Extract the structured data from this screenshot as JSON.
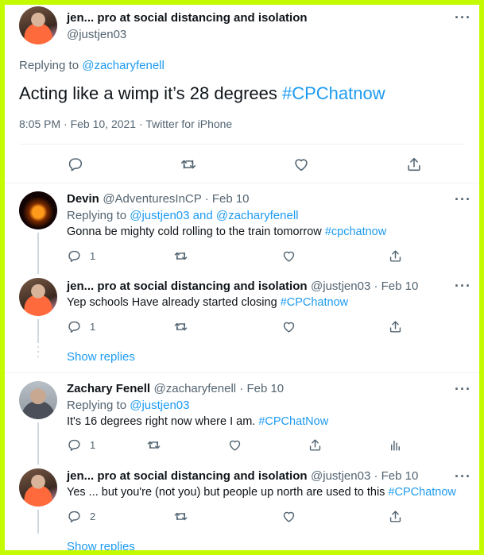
{
  "main_tweet": {
    "author_name": "jen... pro at social distancing and isolation",
    "author_handle": "@justjen03",
    "replying_prefix": "Replying to ",
    "replying_to": "@zacharyfenell",
    "text": "Acting like a wimp it’s 28 degrees ",
    "hashtag": "#CPChatnow",
    "timestamp": "8:05 PM · Feb 10, 2021 · Twitter for iPhone",
    "actions": [
      "reply-icon",
      "retweet-icon",
      "like-icon",
      "share-icon"
    ]
  },
  "replies": [
    {
      "name": "Devin",
      "handle": "@AdventuresInCP · Feb 10",
      "replying_prefix": "Replying to ",
      "replying_to_1": "@justjen03",
      "replying_and": " and ",
      "replying_to_2": "@zacharyfenell",
      "text": "Gonna be mighty cold rolling to the train tomorrow ",
      "hashtag": "#cpchatnow",
      "reply_count": "1"
    },
    {
      "name": "jen... pro at social distancing and isolation",
      "handle": "@justjen03 · Feb 10",
      "text": "Yep schools Have already started closing ",
      "hashtag": "#CPChatnow",
      "reply_count": "1"
    },
    {
      "name": "Zachary Fenell",
      "handle": "@zacharyfenell · Feb 10",
      "replying_prefix": "Replying to ",
      "replying_to": "@justjen03",
      "text": "It's 16 degrees right now where I am. ",
      "hashtag": "#CPChatNow",
      "reply_count": "1"
    },
    {
      "name": "jen... pro at social distancing and isolation",
      "handle": "@justjen03 · Feb 10",
      "text": "Yes ... but you're (not you) but people up north are used to this ",
      "hashtag": "#CPChatnow",
      "reply_count": "2"
    }
  ],
  "show_replies_label": "Show replies",
  "more_label": "···",
  "colors": {
    "border": "#c4fb00",
    "link": "#1d9bf0",
    "muted": "#536471"
  }
}
